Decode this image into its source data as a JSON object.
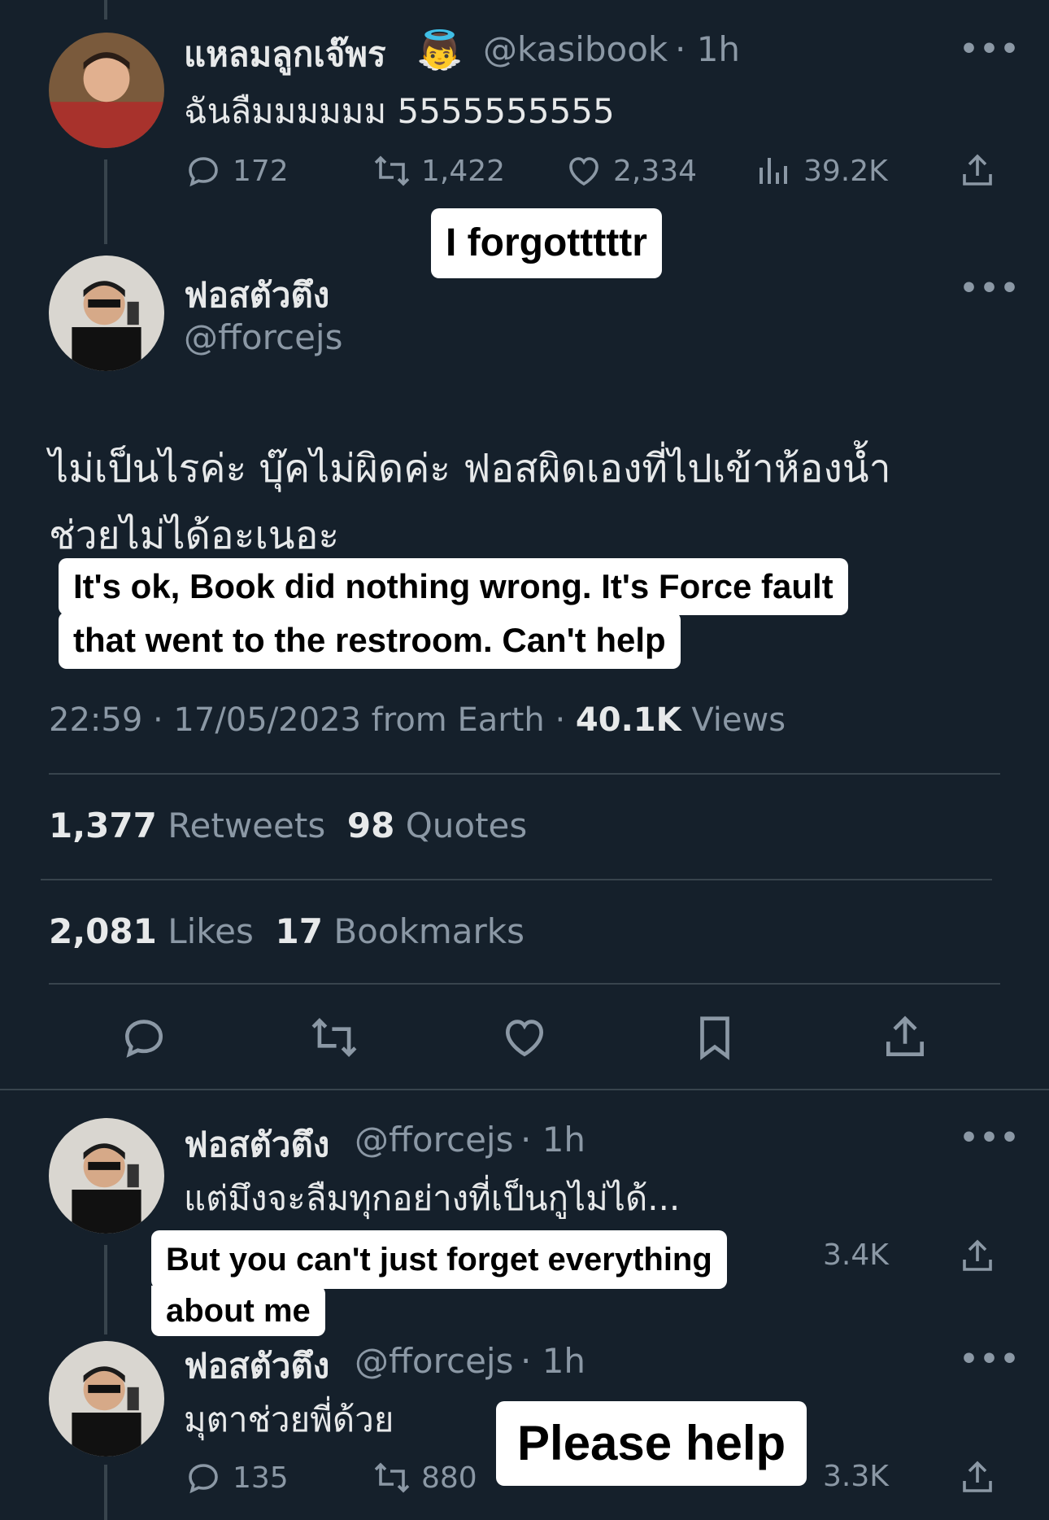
{
  "tweet1": {
    "name": "แหลมลูกเจ๊พร",
    "emoji": "👼",
    "handle": "@kasibook",
    "time": "· 1h",
    "text": "ฉันลืมมมมมม 5555555555",
    "replies": "172",
    "retweets": "1,422",
    "likes": "2,334",
    "views": "39.2K"
  },
  "caption1": "I forgotttttr",
  "main": {
    "name": "ฟอสตัวตึง",
    "handle": "@fforcejs",
    "text_line1": "ไม่เป็นไรค่ะ บุ๊คไม่ผิดค่ะ ฟอสผิดเองที่ไปเข้าห้องน้ำ",
    "text_line2": "ช่วยไม่ได้อะเนอะ",
    "meta_time": "22:59 · 17/05/2023 from Earth ·",
    "meta_views_num": "40.1K",
    "meta_views_lbl": "Views",
    "retweets_num": "1,377",
    "retweets_lbl": "Retweets",
    "quotes_num": "98",
    "quotes_lbl": "Quotes",
    "likes_num": "2,081",
    "likes_lbl": "Likes",
    "bookmarks_num": "17",
    "bookmarks_lbl": "Bookmarks"
  },
  "caption2": {
    "line1": "It's ok, Book did nothing wrong. It's Force fault",
    "line2": "that went to the restroom. Can't help"
  },
  "reply1": {
    "name": "ฟอสตัวตึง",
    "handle": "@fforcejs",
    "time": "· 1h",
    "text": "แต่มึงจะลืมทุกอย่างที่เป็นกูไม่ได้...",
    "views_partial": "3.4K"
  },
  "caption3": {
    "line1": "But you can't just forget everything",
    "line2": "about me"
  },
  "reply2": {
    "name": "ฟอสตัวตึง",
    "handle": "@fforcejs",
    "time": "· 1h",
    "text": "มุตาช่วยพี่ด้วย",
    "replies": "135",
    "retweets": "880",
    "views_partial": "3.3K"
  },
  "caption4": "Please help",
  "icons": {
    "reply": "reply-icon",
    "retweet": "retweet-icon",
    "like": "heart-icon",
    "views": "views-icon",
    "share": "share-icon",
    "bookmark": "bookmark-icon",
    "more": "more-icon"
  },
  "colors": {
    "background": "#15202b",
    "text": "#e7e9ea",
    "secondary": "#8b98a5",
    "caption_bg": "#ffffff"
  }
}
